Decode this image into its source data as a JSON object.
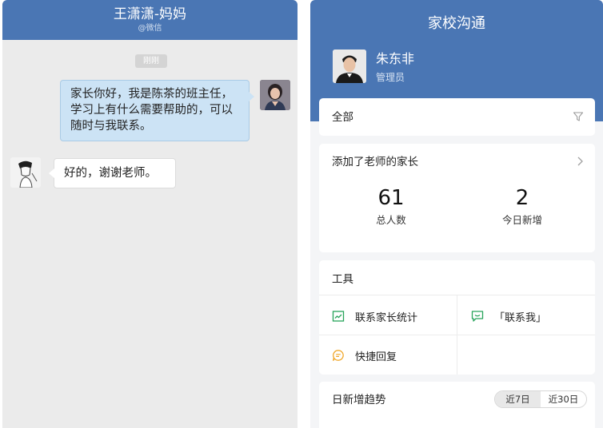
{
  "chat": {
    "title": "王潇潇-妈妈",
    "subtitle": "@微信",
    "timestamp": "刚刚",
    "messages": [
      {
        "direction": "out",
        "text": "家长你好，我是陈茶的班主任，学习上有什么需要帮助的，可以随时与我联系。"
      },
      {
        "direction": "in",
        "text": "好的，谢谢老师。"
      }
    ]
  },
  "app": {
    "title": "家校沟通",
    "user": {
      "name": "朱东非",
      "role": "管理员"
    },
    "filter": {
      "label": "全部",
      "icon": "filter-icon"
    },
    "parents": {
      "title": "添加了老师的家长",
      "stats": [
        {
          "value": "61",
          "label": "总人数"
        },
        {
          "value": "2",
          "label": "今日新增"
        }
      ]
    },
    "tools": {
      "title": "工具",
      "items": [
        {
          "label": "联系家长统计",
          "icon": "chart-icon"
        },
        {
          "label": "「联系我」",
          "icon": "contact-me-icon"
        },
        {
          "label": "快捷回复",
          "icon": "quick-reply-icon"
        }
      ]
    },
    "trend": {
      "title": "日新增趋势",
      "ranges": [
        "近7日",
        "近30日"
      ],
      "selected": "近7日"
    }
  },
  "colors": {
    "header_blue": "#4a76b4",
    "bubble_out": "#cce3f5",
    "icon_green": "#27a35a",
    "icon_orange": "#f0a72a"
  }
}
